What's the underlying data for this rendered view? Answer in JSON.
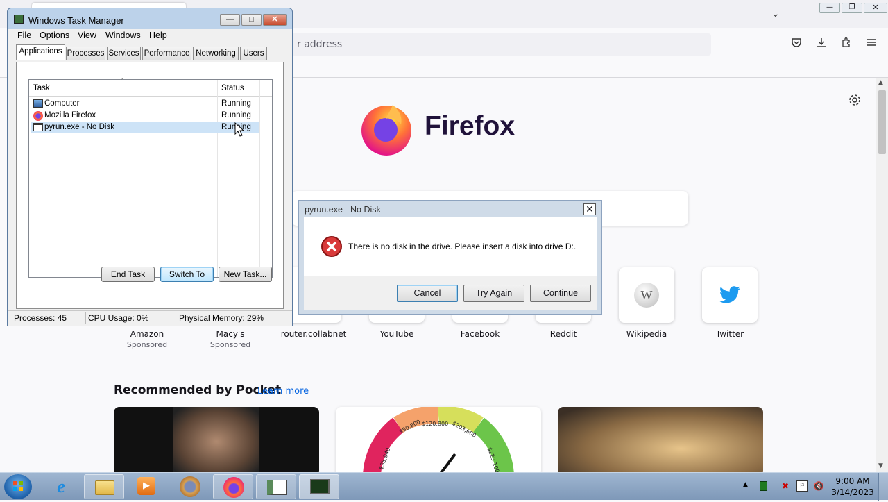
{
  "browser": {
    "address_placeholder": "r address",
    "brand_name": "Firefox",
    "shortcuts": [
      {
        "label": "Amazon",
        "sub": "Sponsored"
      },
      {
        "label": "Macy's",
        "sub": "Sponsored"
      },
      {
        "label": "router.collabnet",
        "sub": ""
      },
      {
        "label": "YouTube",
        "sub": ""
      },
      {
        "label": "Facebook",
        "sub": ""
      },
      {
        "label": "Reddit",
        "sub": ""
      },
      {
        "label": "Wikipedia",
        "sub": ""
      },
      {
        "label": "Twitter",
        "sub": ""
      }
    ],
    "pocket": {
      "heading": "Recommended by Pocket",
      "learn_more": "Learn more"
    },
    "gauge_labels": [
      "$50,800",
      "$120,800",
      "$203,600",
      "$35,940",
      "$229,100"
    ]
  },
  "task_manager": {
    "title": "Windows Task Manager",
    "menu": [
      "File",
      "Options",
      "View",
      "Windows",
      "Help"
    ],
    "tabs": [
      "Applications",
      "Processes",
      "Services",
      "Performance",
      "Networking",
      "Users"
    ],
    "active_tab": "Applications",
    "columns": {
      "task": "Task",
      "status": "Status"
    },
    "rows": [
      {
        "task": "Computer",
        "status": "Running"
      },
      {
        "task": "Mozilla Firefox",
        "status": "Running"
      },
      {
        "task": "pyrun.exe - No Disk",
        "status": "Running"
      }
    ],
    "selected_row": 2,
    "buttons": {
      "end_task": "End Task",
      "switch_to": "Switch To",
      "new_task": "New Task..."
    },
    "status": {
      "processes": "Processes: 45",
      "cpu": "CPU Usage: 0%",
      "memory": "Physical Memory: 29%"
    }
  },
  "dialog": {
    "title": "pyrun.exe - No Disk",
    "message": "There is no disk in the drive. Please insert a disk into drive D:.",
    "buttons": {
      "cancel": "Cancel",
      "try_again": "Try Again",
      "continue": "Continue"
    }
  },
  "taskbar": {
    "time": "9:00 AM",
    "date": "3/14/2023"
  }
}
